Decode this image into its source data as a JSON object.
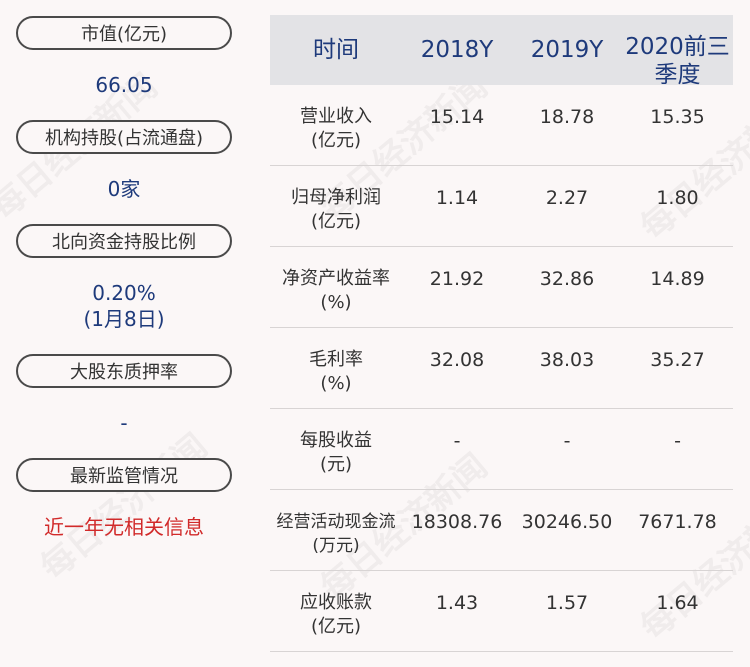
{
  "left": {
    "items": [
      {
        "label": "市值(亿元)",
        "value": "66.05"
      },
      {
        "label": "机构持股(占流通盘)",
        "value": "0家"
      },
      {
        "label": "北向资金持股比例",
        "value": "0.20%",
        "value2": "(1月8日)"
      },
      {
        "label": "大股东质押率",
        "value": "-"
      },
      {
        "label": "最新监管情况",
        "value": "近一年无相关信息"
      }
    ]
  },
  "table": {
    "headers": [
      "时间",
      "2018Y",
      "2019Y",
      "2020前三",
      "季度"
    ],
    "rows": [
      {
        "label1": "营业收入",
        "label2": "(亿元)",
        "v": [
          "15.14",
          "18.78",
          "15.35"
        ]
      },
      {
        "label1": "归母净利润",
        "label2": "(亿元)",
        "v": [
          "1.14",
          "2.27",
          "1.80"
        ]
      },
      {
        "label1": "净资产收益率",
        "label2": "(%)",
        "v": [
          "21.92",
          "32.86",
          "14.89"
        ]
      },
      {
        "label1": "毛利率",
        "label2": "(%)",
        "v": [
          "32.08",
          "38.03",
          "35.27"
        ]
      },
      {
        "label1": "每股收益",
        "label2": "(元)",
        "v": [
          "-",
          "-",
          "-"
        ]
      },
      {
        "label1": "经营活动现金流",
        "label2": "(万元)",
        "v": [
          "18308.76",
          "30246.50",
          "7671.78"
        ]
      },
      {
        "label1": "应收账款",
        "label2": "(亿元)",
        "v": [
          "1.43",
          "1.57",
          "1.64"
        ]
      }
    ]
  },
  "watermark": "每日经济新闻",
  "colors": {
    "value_blue": "#1e3a7b",
    "alert_red": "#d12a2a",
    "header_bg": "#e3e3e6"
  }
}
